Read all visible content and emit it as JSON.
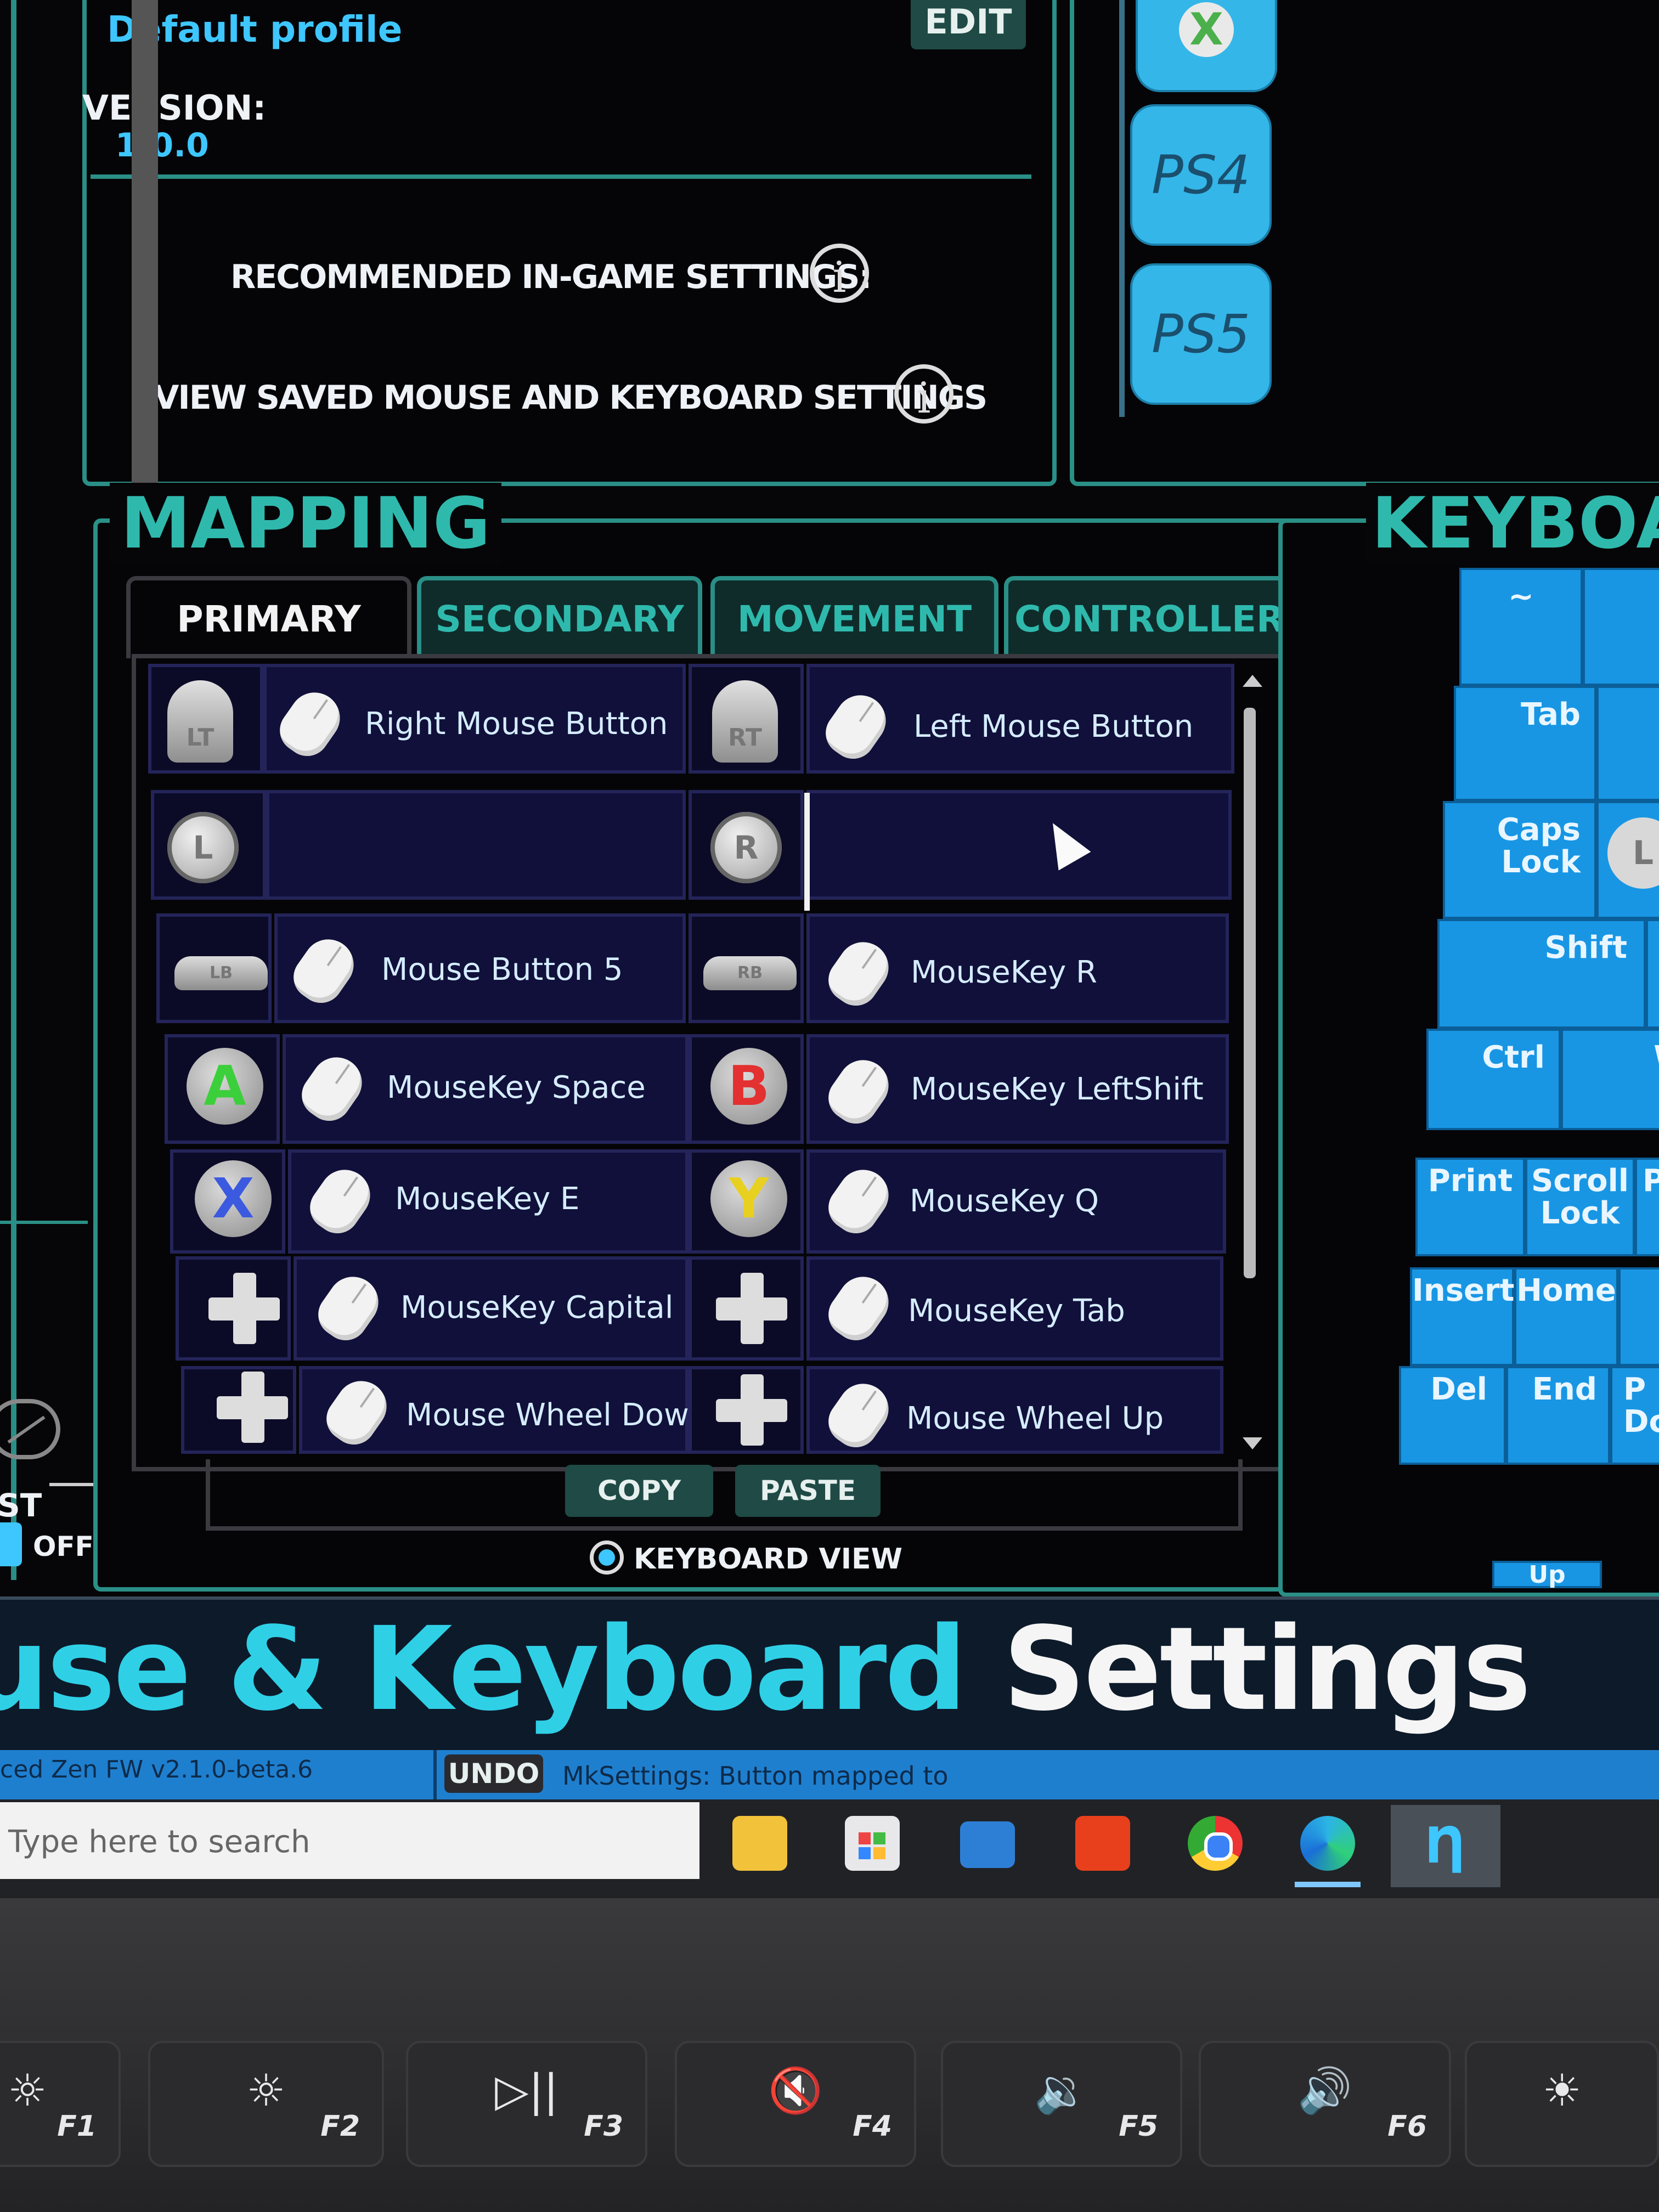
{
  "profile": {
    "name": "Default profile",
    "edit_label": "EDIT",
    "version_label": "VERSION:",
    "version_value": "1.0.0"
  },
  "info_rows": [
    {
      "label": "RECOMMENDED IN-GAME SETTINGS:"
    },
    {
      "label": "VIEW SAVED MOUSE AND KEYBOARD SETTINGS"
    }
  ],
  "consoles": {
    "ps4": "PS4",
    "ps5": "PS5"
  },
  "mapping": {
    "title": "MAPPING",
    "tabs": [
      "PRIMARY",
      "SECONDARY",
      "MOVEMENT",
      "CONTROLLER"
    ],
    "rows": [
      {
        "left_btn": "LT",
        "left_map": "Right Mouse Button",
        "right_btn": "RT",
        "right_map": "Left Mouse Button"
      },
      {
        "left_btn": "L",
        "left_map": "",
        "right_btn": "R",
        "right_map": ""
      },
      {
        "left_btn": "LB",
        "left_map": "Mouse Button 5",
        "right_btn": "RB",
        "right_map": "MouseKey R"
      },
      {
        "left_btn": "A",
        "left_map": "MouseKey Space",
        "right_btn": "B",
        "right_map": "MouseKey LeftShift"
      },
      {
        "left_btn": "X",
        "left_map": "MouseKey E",
        "right_btn": "Y",
        "right_map": "MouseKey Q"
      },
      {
        "left_btn": "dpad",
        "left_map": "MouseKey Capital",
        "right_btn": "dpad",
        "right_map": "MouseKey Tab"
      },
      {
        "left_btn": "dpad",
        "left_map": "Mouse Wheel Down",
        "right_btn": "dpad",
        "right_map": "Mouse Wheel Up"
      }
    ],
    "copy_label": "COPY",
    "paste_label": "PASTE",
    "keyboard_view_label": "KEYBOARD VIEW"
  },
  "left_panel": {
    "partial_label": "ST",
    "toggle_label": "OFF"
  },
  "keyboard": {
    "title": "KEYBOA",
    "keys": {
      "tilde": "~",
      "tab": "Tab",
      "caps1": "Caps",
      "caps2": "Lock",
      "shift": "Shift",
      "ctrl": "Ctrl",
      "w": "W",
      "print": "Print",
      "scroll1": "Scroll",
      "scroll2": "Lock",
      "p_partial": "P",
      "insert": "Insert",
      "home": "Home",
      "del": "Del",
      "end": "End",
      "pd1": "P",
      "pd2": "Dc",
      "up": "Up",
      "l_icon": "L"
    }
  },
  "banner": {
    "part1": "use & Keyboard",
    "part2": "Settings"
  },
  "status_bar": {
    "firmware": "ced Zen FW v2.1.0-beta.6",
    "undo": "UNDO",
    "message": "MkSettings: Button mapped to"
  },
  "taskbar": {
    "search_placeholder": "Type here to search"
  },
  "fkeys": [
    {
      "label": "F1",
      "sym": "☼"
    },
    {
      "label": "F2",
      "sym": "☼"
    },
    {
      "label": "F3",
      "sym": "▷||"
    },
    {
      "label": "F4",
      "sym": "🔇"
    },
    {
      "label": "F5",
      "sym": "🔉"
    },
    {
      "label": "F6",
      "sym": "🔊"
    },
    {
      "label": "",
      "sym": "☀"
    }
  ],
  "colors": {
    "accent_teal": "#2a8f86",
    "key_blue": "#1896e4",
    "text_cyan": "#3ec6ff"
  }
}
